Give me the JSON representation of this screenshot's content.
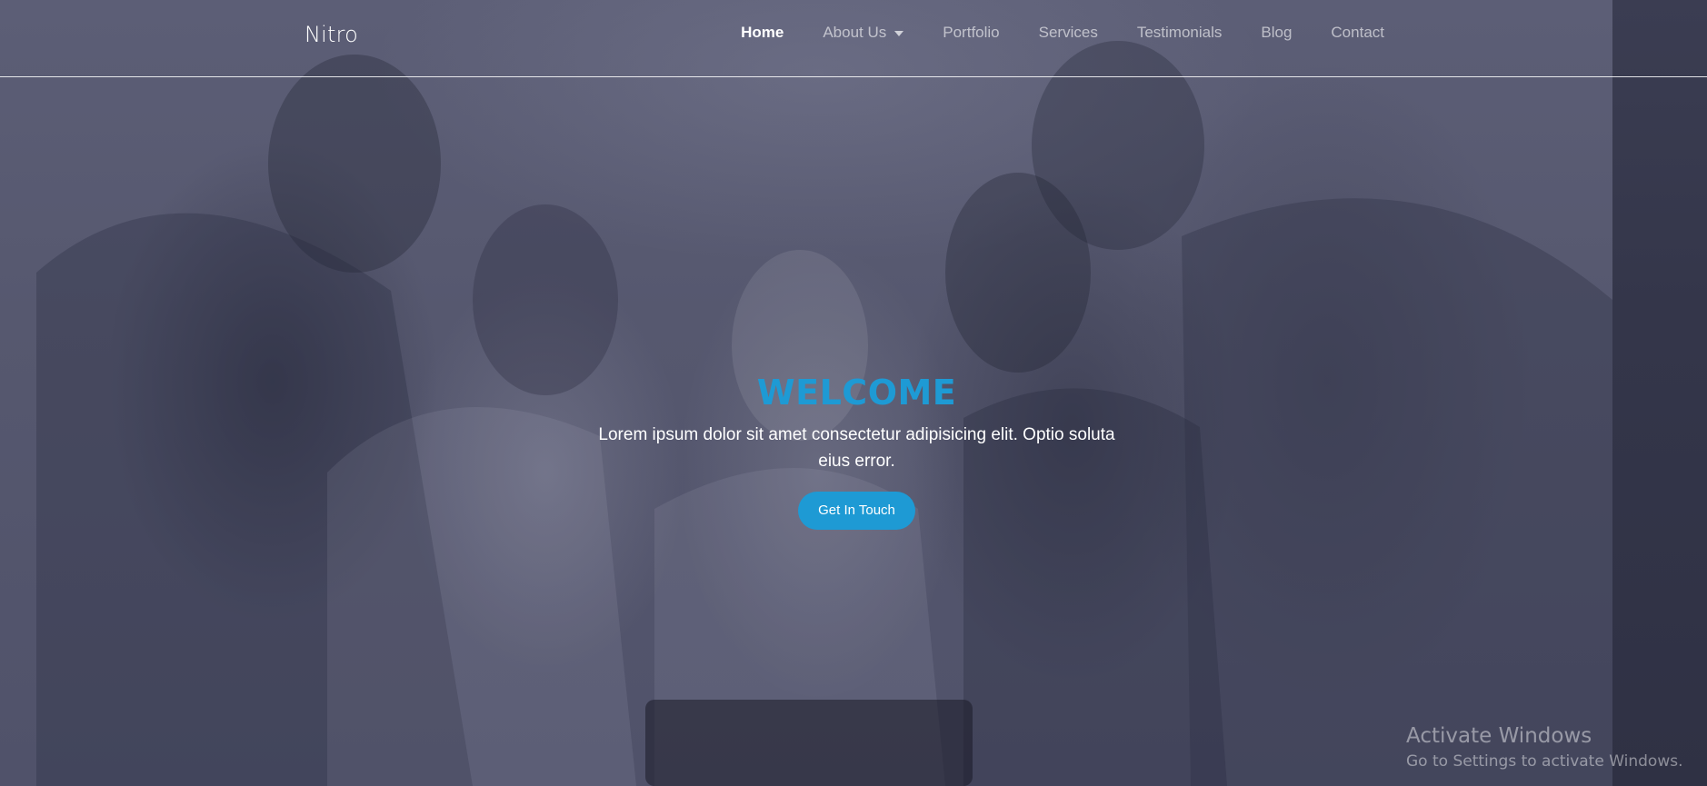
{
  "navbar": {
    "brand": "Nitro",
    "items": [
      {
        "label": "Home",
        "active": true
      },
      {
        "label": "About Us",
        "dropdown": true
      },
      {
        "label": "Portfolio"
      },
      {
        "label": "Services"
      },
      {
        "label": "Testimonials"
      },
      {
        "label": "Blog"
      },
      {
        "label": "Contact"
      }
    ]
  },
  "hero": {
    "title": "WELCOME",
    "text": "Lorem ipsum dolor sit amet consectetur adipisicing elit. Optio soluta eius error.",
    "button_label": "Get In Touch"
  },
  "watermark": {
    "title": "Activate Windows",
    "subtitle": "Go to Settings to activate Windows."
  },
  "colors": {
    "accent": "#1e9ad4",
    "overlay": "#50526a",
    "text": "#ffffff"
  },
  "icons": {
    "dropdown": "chevron-down-icon"
  }
}
